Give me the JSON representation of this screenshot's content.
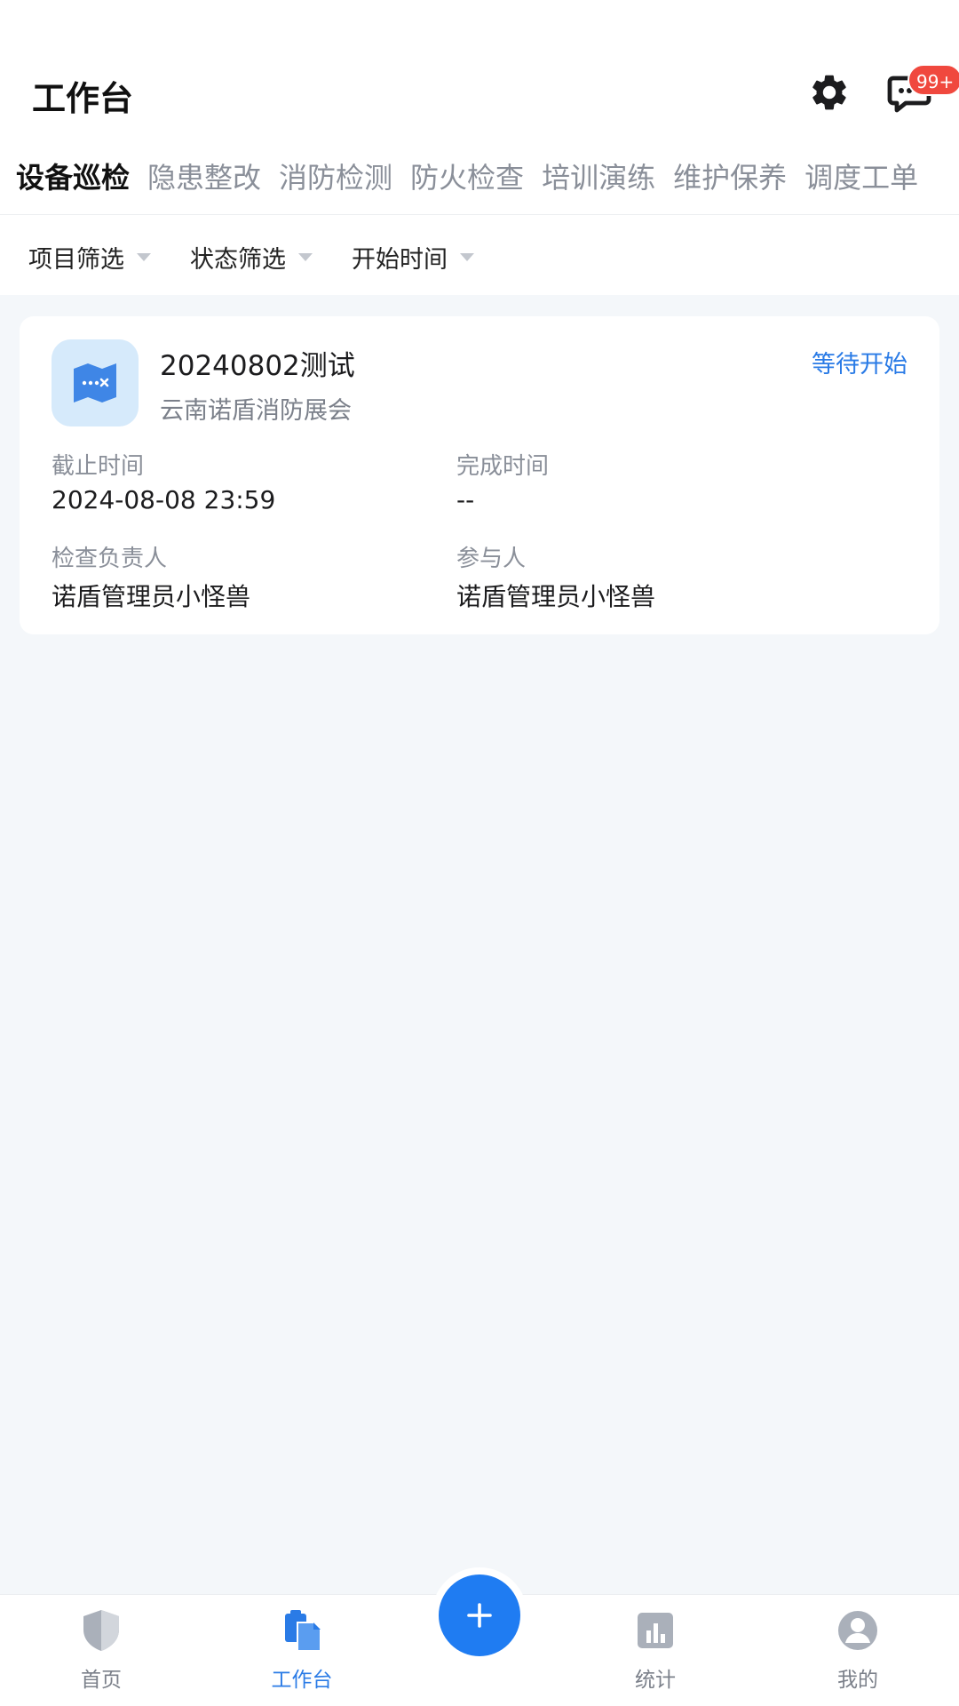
{
  "header": {
    "title": "工作台",
    "message_badge": "99+"
  },
  "tabs": [
    {
      "label": "设备巡检",
      "active": true
    },
    {
      "label": "隐患整改",
      "active": false
    },
    {
      "label": "消防检测",
      "active": false
    },
    {
      "label": "防火检查",
      "active": false
    },
    {
      "label": "培训演练",
      "active": false
    },
    {
      "label": "维护保养",
      "active": false
    },
    {
      "label": "调度工单",
      "active": false
    }
  ],
  "filters": {
    "project": "项目筛选",
    "status": "状态筛选",
    "start_time": "开始时间"
  },
  "task": {
    "title": "20240802测试",
    "org": "云南诺盾消防展会",
    "status": "等待开始",
    "deadline_label": "截止时间",
    "deadline_value": "2024-08-08 23:59",
    "completion_label": "完成时间",
    "completion_value": "--",
    "inspector_label": "检查负责人",
    "inspector_value": "诺盾管理员小怪兽",
    "participant_label": "参与人",
    "participant_value": "诺盾管理员小怪兽"
  },
  "nav": {
    "home": "首页",
    "workbench": "工作台",
    "stats": "统计",
    "mine": "我的"
  },
  "colors": {
    "accent": "#1f7cf2",
    "status_text": "#2a7be6",
    "badge": "#f0483e",
    "background": "#f4f7fa"
  },
  "icons": {
    "settings": "gear-icon",
    "messages": "chat-bubble-icon",
    "task": "map-icon",
    "home": "shield-icon",
    "workbench": "clipboard-icon",
    "stats": "bar-chart-icon",
    "mine": "user-icon",
    "add": "plus-icon"
  }
}
